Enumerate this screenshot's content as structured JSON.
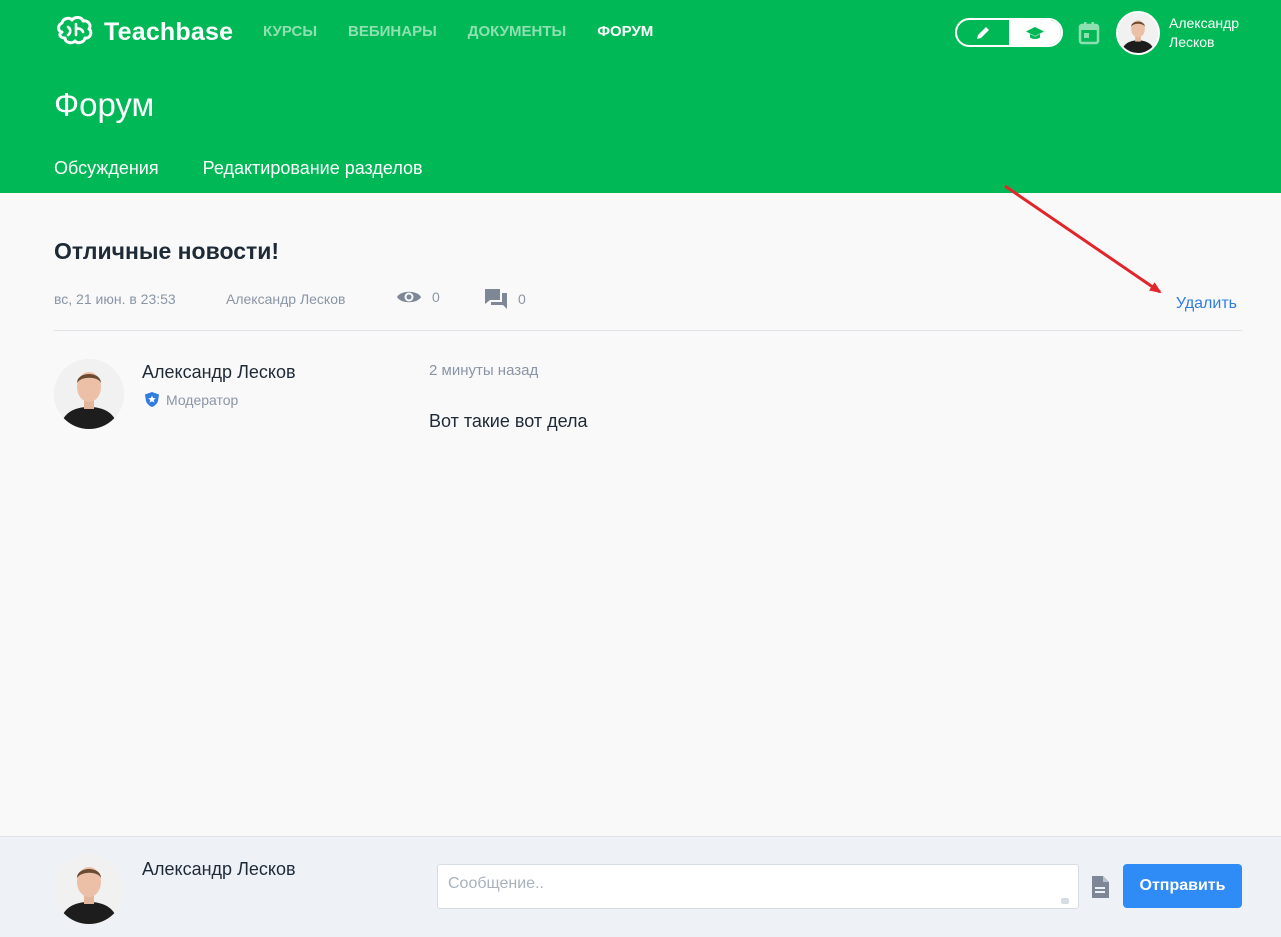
{
  "brand": {
    "name": "Teachbase",
    "accent": "#00b956"
  },
  "nav": [
    {
      "label": "КУРСЫ",
      "active": false
    },
    {
      "label": "ВЕБИНАРЫ",
      "active": false
    },
    {
      "label": "ДОКУМЕНТЫ",
      "active": false
    },
    {
      "label": "ФОРУМ",
      "active": true
    }
  ],
  "mode_toggle": {
    "left_icon": "pencil-icon",
    "right_icon": "graduation-cap-icon",
    "selected": "right"
  },
  "user": {
    "name": "Александр Лесков"
  },
  "page": {
    "title": "Форум",
    "subnav": [
      "Обсуждения",
      "Редактирование разделов"
    ]
  },
  "topic": {
    "title": "Отличные новости!",
    "date": "вс, 21 июн. в 23:53",
    "author": "Александр Лесков",
    "views": "0",
    "comments": "0",
    "delete_label": "Удалить"
  },
  "post": {
    "author": "Александр Лесков",
    "role": "Модератор",
    "time": "2 минуты назад",
    "text": "Вот такие вот дела"
  },
  "composer": {
    "name": "Александр Лесков",
    "placeholder": "Сообщение..",
    "send_label": "Отправить"
  }
}
